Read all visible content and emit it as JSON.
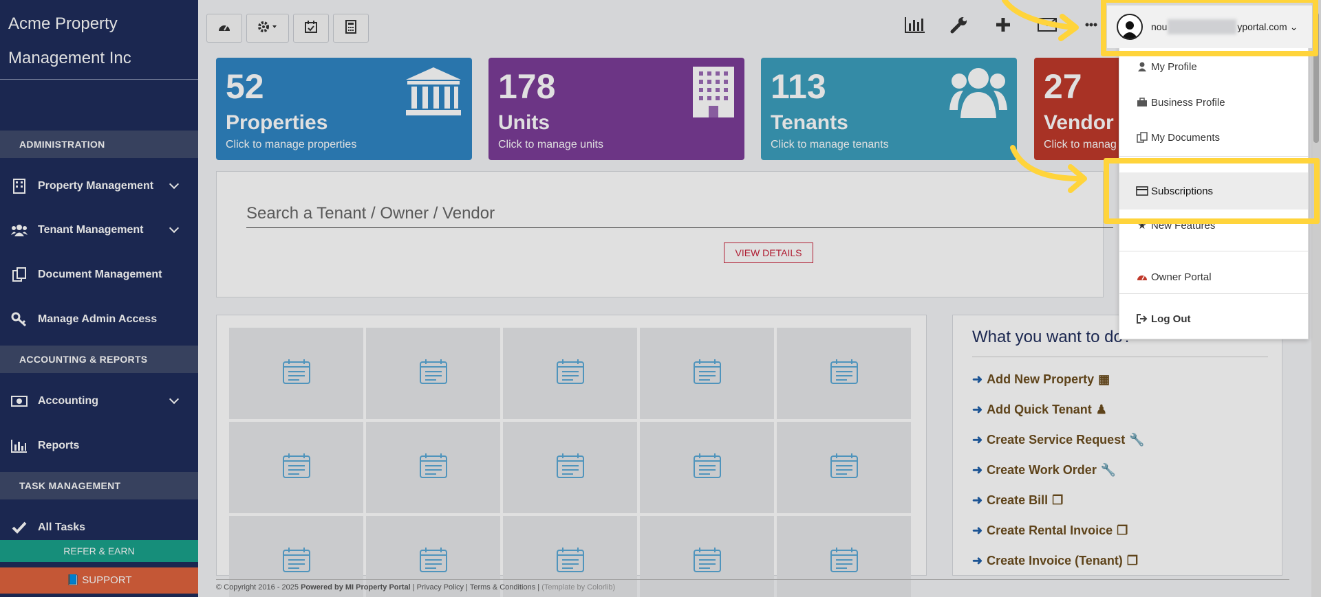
{
  "sidebar": {
    "brand": "Acme Property Management Inc",
    "sections": {
      "administration": "ADMINISTRATION",
      "accounting": "ACCOUNTING & REPORTS",
      "tasks": "TASK MANAGEMENT"
    },
    "items": {
      "property_management": "Property Management",
      "tenant_management": "Tenant Management",
      "document_management": "Document Management",
      "manage_admin_access": "Manage Admin Access",
      "accounting": "Accounting",
      "reports": "Reports",
      "all_tasks": "All Tasks"
    },
    "refer": "REFER & EARN",
    "support": "SUPPORT"
  },
  "stats": [
    {
      "number": "52",
      "label": "Properties",
      "sub": "Click to manage properties",
      "color": "#2f86c4"
    },
    {
      "number": "178",
      "label": "Units",
      "sub": "Click to manage units",
      "color": "#7c3d98"
    },
    {
      "number": "113",
      "label": "Tenants",
      "sub": "Click to manage tenants",
      "color": "#3c9fbd"
    },
    {
      "number": "27",
      "label": "Vendor",
      "sub": "Click to manag",
      "color": "#c0392b"
    }
  ],
  "search": {
    "placeholder": "Search a Tenant / Owner / Vendor",
    "button": "VIEW DETAILS"
  },
  "actions": {
    "title": "What you want to do?",
    "items": [
      "Add New Property",
      "Add Quick Tenant",
      "Create Service Request",
      "Create Work Order",
      "Create Bill",
      "Create Rental Invoice",
      "Create Invoice (Tenant)"
    ]
  },
  "user": {
    "email_start": "nou",
    "email_end": "yportal.com"
  },
  "dropdown": {
    "my_profile": "My Profile",
    "business_profile": "Business Profile",
    "my_documents": "My Documents",
    "subscriptions": "Subscriptions",
    "new_features": "New Features",
    "owner_portal": "Owner Portal",
    "log_out": "Log Out"
  },
  "footer": {
    "copyright": "© Copyright 2016 - 2025",
    "powered": "Powered by MI Property Portal",
    "links": "| Privacy Policy | Terms & Conditions |",
    "template": "(Template by Colorlib)"
  },
  "colors": {
    "highlight": "#ffd43b",
    "sidebar": "#1f2d5c"
  }
}
